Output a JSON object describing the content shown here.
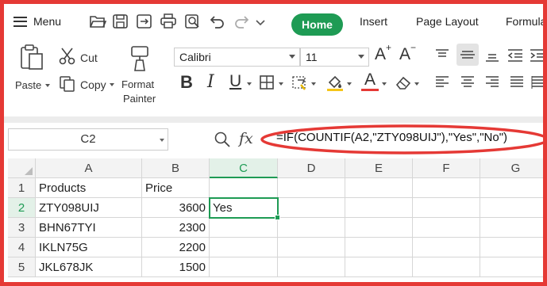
{
  "menubar": {
    "menu_label": "Menu",
    "tabs": [
      "Home",
      "Insert",
      "Page Layout",
      "Formula"
    ],
    "active_tab": "Home",
    "accent_color": "#1e9b54"
  },
  "ribbon": {
    "paste_label": "Paste",
    "cut_label": "Cut",
    "copy_label": "Copy",
    "format_painter_line1": "Format",
    "format_painter_line2": "Painter",
    "font_name": "Calibri",
    "font_size": "11",
    "bold_label": "B",
    "italic_label": "I",
    "underline_label": "U",
    "font_color_label": "A",
    "increase_font_label": "A",
    "decrease_font_label": "A"
  },
  "formula_bar": {
    "cell_reference": "C2",
    "fx_label": "fx",
    "formula": "=IF(COUNTIF(A2,\"ZTY098UIJ\"),\"Yes\",\"No\")",
    "highlight_color": "#e53935"
  },
  "sheet": {
    "columns": [
      "A",
      "B",
      "C",
      "D",
      "E",
      "F",
      "G"
    ],
    "rows": [
      "1",
      "2",
      "3",
      "4",
      "5"
    ],
    "cells": {
      "A1": "Products",
      "B1": "Price",
      "A2": "ZTY098UIJ",
      "B2": "3600",
      "C2": "Yes",
      "A3": "BHN67TYI",
      "B3": "2300",
      "A4": "IKLN75G",
      "B4": "2200",
      "A5": "JKL678JK",
      "B5": "1500"
    },
    "active_cell": "C2"
  }
}
